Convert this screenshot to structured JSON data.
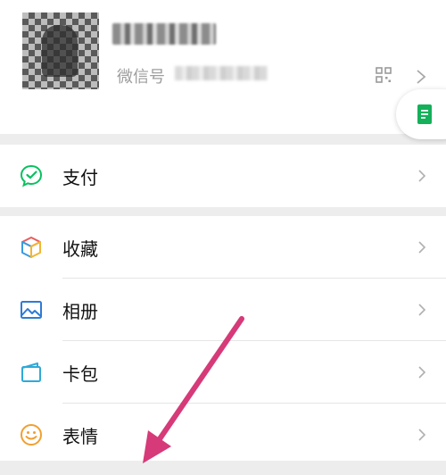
{
  "profile": {
    "wechat_id_label": "微信号"
  },
  "menu": {
    "pay": {
      "label": "支付"
    },
    "favorites": {
      "label": "收藏"
    },
    "album": {
      "label": "相册"
    },
    "cards": {
      "label": "卡包"
    },
    "stickers": {
      "label": "表情"
    }
  },
  "colors": {
    "pay_icon": "#07c160",
    "album_icon": "#2f7bd5",
    "cards_icon": "#2fa9d8",
    "stickers_icon": "#f0a030",
    "annotation_arrow": "#d63a78",
    "float_button_icon": "#15b05a"
  },
  "icons": {
    "qr": "qr-code-icon",
    "pay": "wechat-pay-icon",
    "favorites": "cube-icon",
    "album": "image-icon",
    "cards": "wallet-icon",
    "stickers": "smiley-icon",
    "float": "document-icon"
  }
}
